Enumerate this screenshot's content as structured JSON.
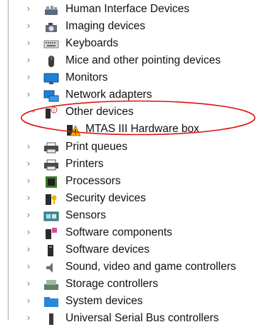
{
  "tree": {
    "categories": [
      {
        "label": "Human Interface Devices",
        "icon": "hid-icon"
      },
      {
        "label": "Imaging devices",
        "icon": "camera-icon"
      },
      {
        "label": "Keyboards",
        "icon": "keyboard-icon"
      },
      {
        "label": "Mice and other pointing devices",
        "icon": "mouse-icon"
      },
      {
        "label": "Monitors",
        "icon": "monitor-icon"
      },
      {
        "label": "Network adapters",
        "icon": "network-adapter-icon"
      },
      {
        "label": "Other devices",
        "icon": "unknown-device-icon",
        "expanded": true
      },
      {
        "label": "MTAS III Hardware box",
        "icon": "warning-device-icon",
        "child": true
      },
      {
        "label": "Print queues",
        "icon": "printer-icon"
      },
      {
        "label": "Printers",
        "icon": "printer-icon"
      },
      {
        "label": "Processors",
        "icon": "processor-icon"
      },
      {
        "label": "Security devices",
        "icon": "security-key-icon"
      },
      {
        "label": "Sensors",
        "icon": "sensor-icon"
      },
      {
        "label": "Software components",
        "icon": "puzzle-icon"
      },
      {
        "label": "Software devices",
        "icon": "software-device-icon"
      },
      {
        "label": "Sound, video and game controllers",
        "icon": "speaker-icon"
      },
      {
        "label": "Storage controllers",
        "icon": "storage-controller-icon"
      },
      {
        "label": "System devices",
        "icon": "folder-icon"
      },
      {
        "label": "Universal Serial Bus controllers",
        "icon": "usb-icon"
      }
    ],
    "colors": {
      "annotation": "#e01010",
      "monitor": "#1e7fd6",
      "warning": "#f0b400"
    }
  }
}
